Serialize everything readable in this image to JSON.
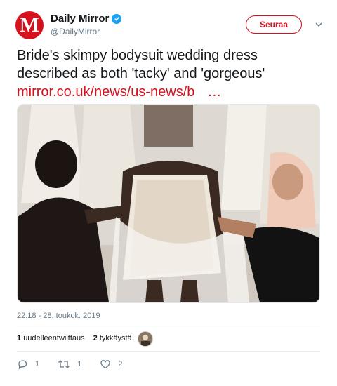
{
  "account": {
    "display_name": "Daily Mirror",
    "handle": "@DailyMirror",
    "avatar_letter": "M",
    "brand_color": "#d6111b",
    "verified_color": "#1da1f2"
  },
  "follow_label": "Seuraa",
  "tweet": {
    "text": "Bride's skimpy bodysuit wedding dress described as both 'tacky' and 'gorgeous'",
    "link": "mirror.co.uk/news/us-news/b",
    "ellipsis": "…"
  },
  "timestamp": "22.18 - 28. toukok. 2019",
  "stats": {
    "retweets_count": "1",
    "retweets_label": "uudelleentwiittaus",
    "likes_count": "2",
    "likes_label": "tykkäystä"
  },
  "actions": {
    "reply_count": "1",
    "retweet_count": "1",
    "like_count": "2"
  },
  "icons": [
    "verified-icon",
    "chevron-down-icon",
    "reply-icon",
    "retweet-icon",
    "heart-icon"
  ]
}
